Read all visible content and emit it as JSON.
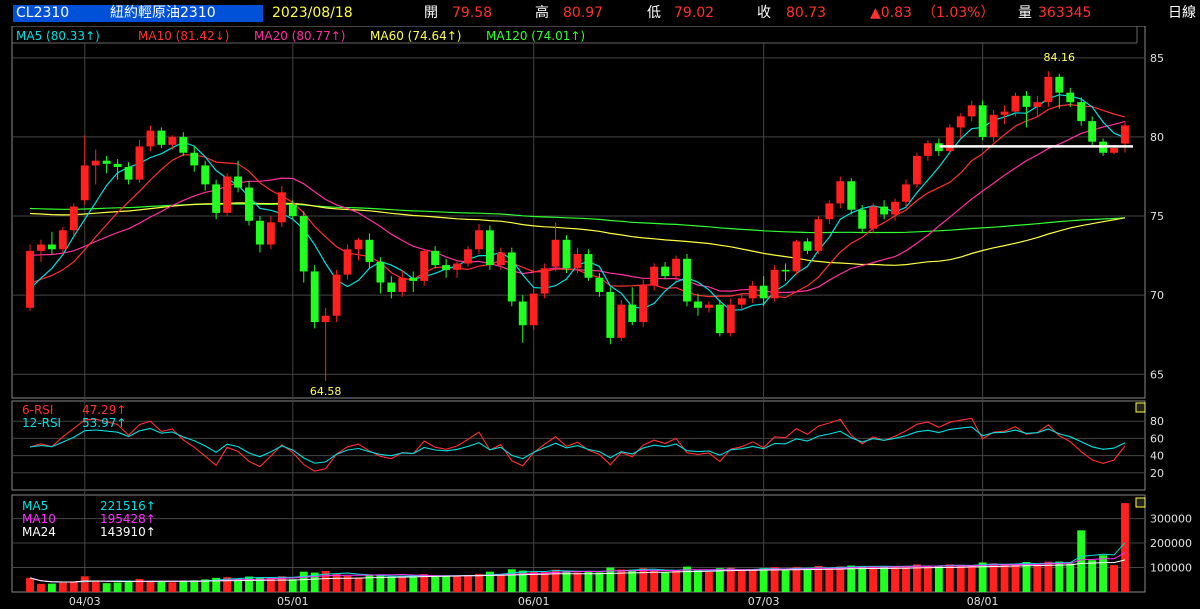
{
  "header": {
    "symbol": "CL2310",
    "name": "紐約輕原油2310",
    "date": "2023/08/18",
    "open_label": "開",
    "open": "79.58",
    "high_label": "高",
    "high": "80.97",
    "low_label": "低",
    "low": "79.02",
    "close_label": "收",
    "close": "80.73",
    "change": "▲0.83",
    "change_pct": "（1.03%）",
    "volume_label": "量",
    "volume": "363345",
    "period": "日線"
  },
  "ma_legend": [
    {
      "label": "MA5",
      "value": "(80.33↑)",
      "color": "#00e0e0"
    },
    {
      "label": "MA10",
      "value": "(81.42↓)",
      "color": "#ff3030"
    },
    {
      "label": "MA20",
      "value": "(80.77↑)",
      "color": "#ff30a0"
    },
    {
      "label": "MA60",
      "value": "(74.64↑)",
      "color": "#ffff40"
    },
    {
      "label": "MA120",
      "value": "(74.01↑)",
      "color": "#30ff30"
    }
  ],
  "rsi_legend": [
    {
      "label": "6-RSI",
      "value": "47.29↑",
      "color": "#ff3030"
    },
    {
      "label": "12-RSI",
      "value": "53.97↑",
      "color": "#00e0e0"
    }
  ],
  "vol_legend": [
    {
      "label": "MA5",
      "value": "221516↑",
      "color": "#00e0e0"
    },
    {
      "label": "MA10",
      "value": "195428↑",
      "color": "#ff30ff"
    },
    {
      "label": "MA24",
      "value": "143910↑",
      "color": "#ffffff"
    }
  ],
  "colors": {
    "up": "#ff2020",
    "down": "#20ff20",
    "grid": "#444444",
    "axis_text": "#e0e0e0"
  },
  "chart_data": {
    "type": "candlestick",
    "x_labels": [
      "04/03",
      "05/01",
      "06/01",
      "07/03",
      "08/01"
    ],
    "x_label_dates": [
      "2023-04-03",
      "2023-05-01",
      "2023-06-01",
      "2023-07-03",
      "2023-08-01"
    ],
    "price_axis": {
      "ticks": [
        65,
        70,
        75,
        80,
        85
      ],
      "range": [
        63.5,
        86.0
      ]
    },
    "annotations": [
      {
        "text": "84.16",
        "kind": "high",
        "date": "2023-08-10",
        "value": 84.16
      },
      {
        "text": "64.58",
        "kind": "low",
        "date": "2023-05-04",
        "value": 64.58
      }
    ],
    "support_line": {
      "value": 79.4,
      "from": "2023-07-26",
      "to": "2023-08-18"
    },
    "candles": [
      {
        "d": "2023-03-27",
        "o": 69.2,
        "h": 73.2,
        "l": 69.0,
        "c": 72.8
      },
      {
        "d": "2023-03-28",
        "o": 72.8,
        "h": 73.5,
        "l": 72.1,
        "c": 73.2
      },
      {
        "d": "2023-03-29",
        "o": 73.2,
        "h": 74.0,
        "l": 72.6,
        "c": 72.9
      },
      {
        "d": "2023-03-30",
        "o": 72.9,
        "h": 74.3,
        "l": 72.6,
        "c": 74.1
      },
      {
        "d": "2023-03-31",
        "o": 74.1,
        "h": 75.8,
        "l": 73.8,
        "c": 75.6
      },
      {
        "d": "2023-04-03",
        "o": 76.0,
        "h": 80.1,
        "l": 75.7,
        "c": 78.2
      },
      {
        "d": "2023-04-04",
        "o": 78.2,
        "h": 79.2,
        "l": 77.0,
        "c": 78.5
      },
      {
        "d": "2023-04-05",
        "o": 78.5,
        "h": 78.8,
        "l": 77.7,
        "c": 78.3
      },
      {
        "d": "2023-04-06",
        "o": 78.3,
        "h": 78.6,
        "l": 77.3,
        "c": 78.1
      },
      {
        "d": "2023-04-10",
        "o": 78.1,
        "h": 78.4,
        "l": 77.0,
        "c": 77.3
      },
      {
        "d": "2023-04-11",
        "o": 77.3,
        "h": 79.8,
        "l": 77.1,
        "c": 79.4
      },
      {
        "d": "2023-04-12",
        "o": 79.4,
        "h": 80.7,
        "l": 79.1,
        "c": 80.4
      },
      {
        "d": "2023-04-13",
        "o": 80.4,
        "h": 80.6,
        "l": 79.3,
        "c": 79.5
      },
      {
        "d": "2023-04-14",
        "o": 79.5,
        "h": 80.1,
        "l": 79.2,
        "c": 80.0
      },
      {
        "d": "2023-04-17",
        "o": 80.0,
        "h": 80.3,
        "l": 78.8,
        "c": 79.0
      },
      {
        "d": "2023-04-18",
        "o": 79.0,
        "h": 79.4,
        "l": 77.8,
        "c": 78.2
      },
      {
        "d": "2023-04-19",
        "o": 78.2,
        "h": 78.5,
        "l": 76.6,
        "c": 77.0
      },
      {
        "d": "2023-04-20",
        "o": 77.0,
        "h": 77.3,
        "l": 74.8,
        "c": 75.2
      },
      {
        "d": "2023-04-21",
        "o": 75.2,
        "h": 77.7,
        "l": 75.0,
        "c": 77.5
      },
      {
        "d": "2023-04-24",
        "o": 77.5,
        "h": 78.5,
        "l": 76.5,
        "c": 76.8
      },
      {
        "d": "2023-04-25",
        "o": 76.8,
        "h": 77.2,
        "l": 74.4,
        "c": 74.7
      },
      {
        "d": "2023-04-26",
        "o": 74.7,
        "h": 75.0,
        "l": 72.7,
        "c": 73.2
      },
      {
        "d": "2023-04-27",
        "o": 73.2,
        "h": 75.0,
        "l": 72.9,
        "c": 74.6
      },
      {
        "d": "2023-04-28",
        "o": 74.6,
        "h": 76.9,
        "l": 74.3,
        "c": 76.5
      },
      {
        "d": "2023-05-01",
        "o": 75.7,
        "h": 76.0,
        "l": 74.8,
        "c": 75.0
      },
      {
        "d": "2023-05-02",
        "o": 75.0,
        "h": 75.3,
        "l": 70.8,
        "c": 71.5
      },
      {
        "d": "2023-05-03",
        "o": 71.5,
        "h": 71.9,
        "l": 67.9,
        "c": 68.3
      },
      {
        "d": "2023-05-04",
        "o": 68.3,
        "h": 69.2,
        "l": 64.58,
        "c": 68.7
      },
      {
        "d": "2023-05-05",
        "o": 68.7,
        "h": 71.6,
        "l": 68.3,
        "c": 71.3
      },
      {
        "d": "2023-05-08",
        "o": 71.3,
        "h": 73.2,
        "l": 71.0,
        "c": 72.9
      },
      {
        "d": "2023-05-09",
        "o": 72.9,
        "h": 73.6,
        "l": 72.2,
        "c": 73.5
      },
      {
        "d": "2023-05-10",
        "o": 73.5,
        "h": 73.9,
        "l": 71.7,
        "c": 72.1
      },
      {
        "d": "2023-05-11",
        "o": 72.1,
        "h": 72.4,
        "l": 70.1,
        "c": 70.8
      },
      {
        "d": "2023-05-12",
        "o": 70.8,
        "h": 71.2,
        "l": 69.8,
        "c": 70.2
      },
      {
        "d": "2023-05-15",
        "o": 70.2,
        "h": 71.6,
        "l": 69.9,
        "c": 71.1
      },
      {
        "d": "2023-05-16",
        "o": 71.1,
        "h": 71.5,
        "l": 70.2,
        "c": 70.9
      },
      {
        "d": "2023-05-17",
        "o": 70.9,
        "h": 72.9,
        "l": 70.6,
        "c": 72.8
      },
      {
        "d": "2023-05-18",
        "o": 72.8,
        "h": 73.1,
        "l": 71.7,
        "c": 71.9
      },
      {
        "d": "2023-05-19",
        "o": 71.9,
        "h": 72.3,
        "l": 71.1,
        "c": 71.6
      },
      {
        "d": "2023-05-22",
        "o": 71.6,
        "h": 72.2,
        "l": 71.1,
        "c": 72.0
      },
      {
        "d": "2023-05-23",
        "o": 72.0,
        "h": 73.1,
        "l": 71.8,
        "c": 72.9
      },
      {
        "d": "2023-05-24",
        "o": 72.9,
        "h": 74.5,
        "l": 72.6,
        "c": 74.1
      },
      {
        "d": "2023-05-25",
        "o": 74.1,
        "h": 74.4,
        "l": 71.6,
        "c": 71.9
      },
      {
        "d": "2023-05-26",
        "o": 71.9,
        "h": 73.0,
        "l": 71.6,
        "c": 72.7
      },
      {
        "d": "2023-05-30",
        "o": 72.7,
        "h": 73.0,
        "l": 69.3,
        "c": 69.6
      },
      {
        "d": "2023-05-31",
        "o": 69.6,
        "h": 70.0,
        "l": 67.0,
        "c": 68.1
      },
      {
        "d": "2023-06-01",
        "o": 68.1,
        "h": 70.4,
        "l": 67.8,
        "c": 70.1
      },
      {
        "d": "2023-06-02",
        "o": 70.1,
        "h": 72.0,
        "l": 69.8,
        "c": 71.7
      },
      {
        "d": "2023-06-05",
        "o": 71.8,
        "h": 74.6,
        "l": 71.5,
        "c": 73.5
      },
      {
        "d": "2023-06-06",
        "o": 73.5,
        "h": 73.8,
        "l": 71.4,
        "c": 71.7
      },
      {
        "d": "2023-06-07",
        "o": 71.7,
        "h": 73.0,
        "l": 71.4,
        "c": 72.6
      },
      {
        "d": "2023-06-08",
        "o": 72.6,
        "h": 72.9,
        "l": 70.9,
        "c": 71.1
      },
      {
        "d": "2023-06-09",
        "o": 71.1,
        "h": 71.4,
        "l": 69.9,
        "c": 70.2
      },
      {
        "d": "2023-06-12",
        "o": 70.2,
        "h": 70.5,
        "l": 66.9,
        "c": 67.3
      },
      {
        "d": "2023-06-13",
        "o": 67.3,
        "h": 69.7,
        "l": 67.1,
        "c": 69.4
      },
      {
        "d": "2023-06-14",
        "o": 69.4,
        "h": 70.5,
        "l": 68.1,
        "c": 68.3
      },
      {
        "d": "2023-06-15",
        "o": 68.3,
        "h": 71.0,
        "l": 68.0,
        "c": 70.6
      },
      {
        "d": "2023-06-16",
        "o": 70.6,
        "h": 72.0,
        "l": 70.3,
        "c": 71.8
      },
      {
        "d": "2023-06-20",
        "o": 71.8,
        "h": 72.1,
        "l": 71.0,
        "c": 71.2
      },
      {
        "d": "2023-06-21",
        "o": 71.2,
        "h": 72.5,
        "l": 70.9,
        "c": 72.3
      },
      {
        "d": "2023-06-22",
        "o": 72.3,
        "h": 72.6,
        "l": 69.3,
        "c": 69.6
      },
      {
        "d": "2023-06-23",
        "o": 69.6,
        "h": 70.1,
        "l": 68.7,
        "c": 69.2
      },
      {
        "d": "2023-06-26",
        "o": 69.2,
        "h": 69.6,
        "l": 68.9,
        "c": 69.4
      },
      {
        "d": "2023-06-27",
        "o": 69.4,
        "h": 69.7,
        "l": 67.4,
        "c": 67.6
      },
      {
        "d": "2023-06-28",
        "o": 67.6,
        "h": 69.8,
        "l": 67.4,
        "c": 69.4
      },
      {
        "d": "2023-06-29",
        "o": 69.4,
        "h": 70.1,
        "l": 69.0,
        "c": 69.8
      },
      {
        "d": "2023-06-30",
        "o": 69.8,
        "h": 70.9,
        "l": 69.5,
        "c": 70.6
      },
      {
        "d": "2023-07-03",
        "o": 70.6,
        "h": 71.2,
        "l": 69.3,
        "c": 69.8
      },
      {
        "d": "2023-07-05",
        "o": 69.8,
        "h": 71.9,
        "l": 69.6,
        "c": 71.6
      },
      {
        "d": "2023-07-06",
        "o": 71.6,
        "h": 72.0,
        "l": 70.9,
        "c": 71.5
      },
      {
        "d": "2023-07-07",
        "o": 71.5,
        "h": 73.5,
        "l": 71.3,
        "c": 73.4
      },
      {
        "d": "2023-07-10",
        "o": 73.4,
        "h": 73.6,
        "l": 72.6,
        "c": 72.8
      },
      {
        "d": "2023-07-11",
        "o": 72.8,
        "h": 75.0,
        "l": 72.6,
        "c": 74.8
      },
      {
        "d": "2023-07-12",
        "o": 74.8,
        "h": 76.0,
        "l": 74.5,
        "c": 75.8
      },
      {
        "d": "2023-07-13",
        "o": 75.8,
        "h": 77.5,
        "l": 75.5,
        "c": 77.2
      },
      {
        "d": "2023-07-14",
        "o": 77.2,
        "h": 77.4,
        "l": 75.1,
        "c": 75.4
      },
      {
        "d": "2023-07-17",
        "o": 75.4,
        "h": 75.7,
        "l": 73.9,
        "c": 74.2
      },
      {
        "d": "2023-07-18",
        "o": 74.2,
        "h": 75.8,
        "l": 73.9,
        "c": 75.6
      },
      {
        "d": "2023-07-19",
        "o": 75.6,
        "h": 76.0,
        "l": 74.8,
        "c": 75.1
      },
      {
        "d": "2023-07-20",
        "o": 75.1,
        "h": 76.1,
        "l": 74.7,
        "c": 75.9
      },
      {
        "d": "2023-07-21",
        "o": 75.9,
        "h": 77.3,
        "l": 75.6,
        "c": 77.0
      },
      {
        "d": "2023-07-24",
        "o": 77.0,
        "h": 79.0,
        "l": 76.8,
        "c": 78.8
      },
      {
        "d": "2023-07-25",
        "o": 78.8,
        "h": 79.8,
        "l": 78.5,
        "c": 79.6
      },
      {
        "d": "2023-07-26",
        "o": 79.6,
        "h": 79.9,
        "l": 78.8,
        "c": 79.1
      },
      {
        "d": "2023-07-27",
        "o": 79.1,
        "h": 80.8,
        "l": 78.9,
        "c": 80.6
      },
      {
        "d": "2023-07-28",
        "o": 80.6,
        "h": 81.5,
        "l": 79.9,
        "c": 81.3
      },
      {
        "d": "2023-07-31",
        "o": 81.3,
        "h": 82.3,
        "l": 81.0,
        "c": 82.0
      },
      {
        "d": "2023-08-01",
        "o": 82.0,
        "h": 82.3,
        "l": 79.8,
        "c": 80.0
      },
      {
        "d": "2023-08-02",
        "o": 80.0,
        "h": 81.7,
        "l": 79.7,
        "c": 81.4
      },
      {
        "d": "2023-08-03",
        "o": 81.4,
        "h": 82.0,
        "l": 80.8,
        "c": 81.6
      },
      {
        "d": "2023-08-04",
        "o": 81.6,
        "h": 82.8,
        "l": 81.3,
        "c": 82.6
      },
      {
        "d": "2023-08-07",
        "o": 82.6,
        "h": 82.9,
        "l": 80.6,
        "c": 81.9
      },
      {
        "d": "2023-08-08",
        "o": 81.9,
        "h": 82.6,
        "l": 81.3,
        "c": 82.2
      },
      {
        "d": "2023-08-09",
        "o": 82.2,
        "h": 84.16,
        "l": 81.9,
        "c": 83.8
      },
      {
        "d": "2023-08-10",
        "o": 83.8,
        "h": 84.0,
        "l": 81.8,
        "c": 82.8
      },
      {
        "d": "2023-08-11",
        "o": 82.8,
        "h": 83.1,
        "l": 81.9,
        "c": 82.2
      },
      {
        "d": "2023-08-14",
        "o": 82.2,
        "h": 82.5,
        "l": 80.7,
        "c": 81.0
      },
      {
        "d": "2023-08-15",
        "o": 81.0,
        "h": 81.3,
        "l": 79.5,
        "c": 79.7
      },
      {
        "d": "2023-08-16",
        "o": 79.7,
        "h": 79.9,
        "l": 78.8,
        "c": 79.0
      },
      {
        "d": "2023-08-17",
        "o": 79.0,
        "h": 79.5,
        "l": 78.9,
        "c": 79.3
      },
      {
        "d": "2023-08-18",
        "o": 79.58,
        "h": 80.97,
        "l": 79.02,
        "c": 80.73
      }
    ],
    "rsi_axis": {
      "ticks": [
        20,
        40,
        60,
        80
      ],
      "range": [
        0,
        100
      ]
    },
    "volume_axis": {
      "ticks": [
        100000,
        200000,
        300000
      ],
      "range": [
        0,
        380000
      ]
    }
  }
}
